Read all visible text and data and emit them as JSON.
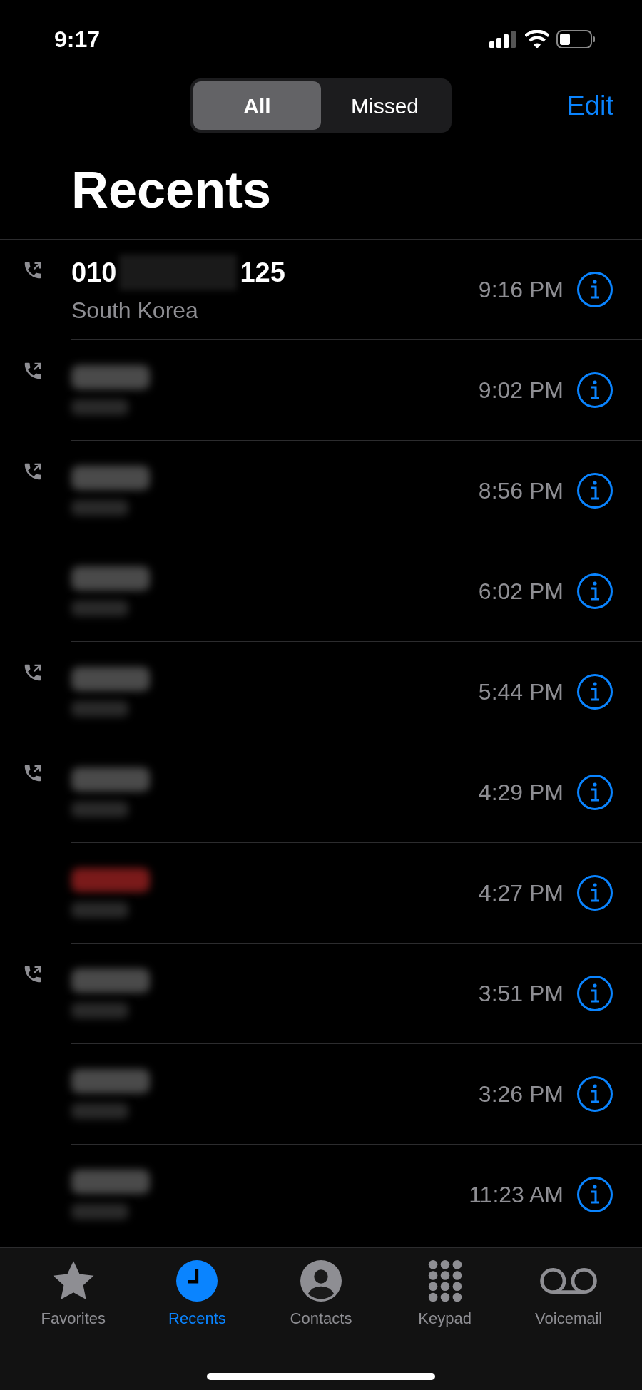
{
  "status_bar": {
    "time": "9:17"
  },
  "segments": [
    {
      "label": "All",
      "selected": true
    },
    {
      "label": "Missed",
      "selected": false
    }
  ],
  "edit": "Edit",
  "title": "Recents",
  "calls": [
    {
      "kind": "number",
      "outgoing": true,
      "missed": false,
      "number_start": "010",
      "number_end": "125",
      "location": "South Korea",
      "time": "9:16 PM"
    },
    {
      "kind": "redacted",
      "outgoing": true,
      "missed": false,
      "time": "9:02 PM"
    },
    {
      "kind": "redacted",
      "outgoing": true,
      "missed": false,
      "time": "8:56 PM"
    },
    {
      "kind": "redacted",
      "outgoing": false,
      "missed": false,
      "time": "6:02 PM"
    },
    {
      "kind": "redacted",
      "outgoing": true,
      "missed": false,
      "time": "5:44 PM"
    },
    {
      "kind": "redacted",
      "outgoing": true,
      "missed": false,
      "time": "4:29 PM"
    },
    {
      "kind": "redacted",
      "outgoing": false,
      "missed": true,
      "time": "4:27 PM"
    },
    {
      "kind": "redacted",
      "outgoing": true,
      "missed": false,
      "time": "3:51 PM"
    },
    {
      "kind": "redacted",
      "outgoing": false,
      "missed": false,
      "time": "3:26 PM"
    },
    {
      "kind": "redacted",
      "outgoing": false,
      "missed": false,
      "time": "11:23 AM"
    }
  ],
  "tabs": [
    {
      "label": "Favorites",
      "selected": false
    },
    {
      "label": "Recents",
      "selected": true
    },
    {
      "label": "Contacts",
      "selected": false
    },
    {
      "label": "Keypad",
      "selected": false
    },
    {
      "label": "Voicemail",
      "selected": false
    }
  ]
}
